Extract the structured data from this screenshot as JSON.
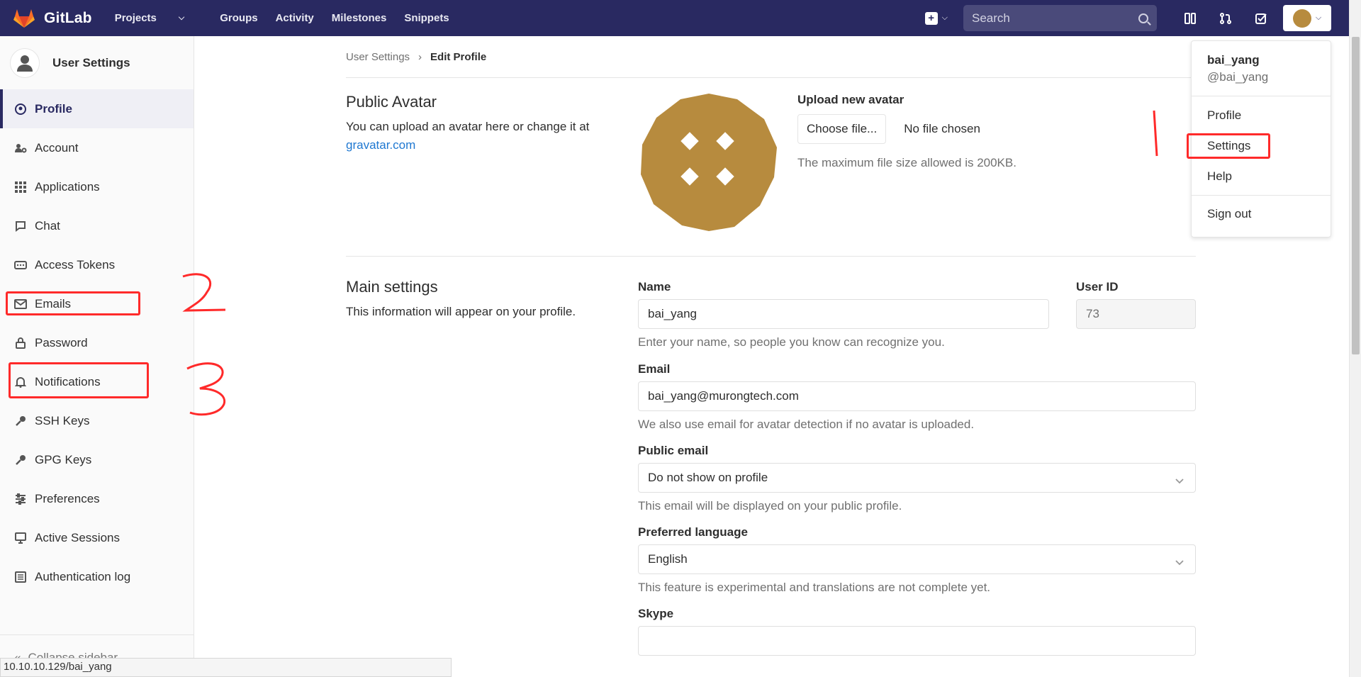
{
  "navbar": {
    "brand": "GitLab",
    "links": [
      {
        "label": "Projects",
        "has_dropdown": true
      },
      {
        "label": "Groups",
        "has_dropdown": false
      },
      {
        "label": "Activity",
        "has_dropdown": false
      },
      {
        "label": "Milestones",
        "has_dropdown": false
      },
      {
        "label": "Snippets",
        "has_dropdown": false
      }
    ],
    "search_placeholder": "Search",
    "colors": {
      "background": "#292961",
      "accent": "#fc6d26"
    }
  },
  "sidebar": {
    "title": "User Settings",
    "items": [
      {
        "label": "Profile",
        "icon": "profile-icon",
        "active": true
      },
      {
        "label": "Account",
        "icon": "account-gears-icon",
        "active": false
      },
      {
        "label": "Applications",
        "icon": "applications-grid-icon",
        "active": false
      },
      {
        "label": "Chat",
        "icon": "chat-bubble-icon",
        "active": false
      },
      {
        "label": "Access Tokens",
        "icon": "access-token-icon",
        "active": false
      },
      {
        "label": "Emails",
        "icon": "envelope-icon",
        "active": false
      },
      {
        "label": "Password",
        "icon": "lock-icon",
        "active": false
      },
      {
        "label": "Notifications",
        "icon": "bell-icon",
        "active": false
      },
      {
        "label": "SSH Keys",
        "icon": "key-icon",
        "active": false
      },
      {
        "label": "GPG Keys",
        "icon": "key-icon",
        "active": false
      },
      {
        "label": "Preferences",
        "icon": "sliders-icon",
        "active": false
      },
      {
        "label": "Active Sessions",
        "icon": "monitor-icon",
        "active": false
      },
      {
        "label": "Authentication log",
        "icon": "log-list-icon",
        "active": false
      }
    ],
    "collapse_label": "Collapse sidebar"
  },
  "breadcrumb": {
    "parent": "User Settings",
    "current": "Edit Profile"
  },
  "avatar_section": {
    "title": "Public Avatar",
    "description": "You can upload an avatar here or change it at",
    "link": "gravatar.com",
    "upload_label": "Upload new avatar",
    "choose_button": "Choose file...",
    "no_file": "No file chosen",
    "max_size": "The maximum file size allowed is 200KB.",
    "avatar_color": "#b78b3e"
  },
  "main_settings": {
    "title": "Main settings",
    "description": "This information will appear on your profile.",
    "name_label": "Name",
    "name_value": "bai_yang",
    "name_help": "Enter your name, so people you know can recognize you.",
    "user_id_label": "User ID",
    "user_id_value": "73",
    "email_label": "Email",
    "email_value": "bai_yang@murongtech.com",
    "email_help": "We also use email for avatar detection if no avatar is uploaded.",
    "public_email_label": "Public email",
    "public_email_value": "Do not show on profile",
    "public_email_help": "This email will be displayed on your public profile.",
    "language_label": "Preferred language",
    "language_value": "English",
    "language_help": "This feature is experimental and translations are not complete yet.",
    "skype_label": "Skype",
    "skype_value": ""
  },
  "user_dropdown": {
    "name": "bai_yang",
    "handle": "@bai_yang",
    "items": [
      "Profile",
      "Settings",
      "Help"
    ],
    "sign_out": "Sign out"
  },
  "status_bar_url": "10.10.10.129/bai_yang",
  "annotations": {
    "color": "#ff2a2a",
    "numbers": [
      "1",
      "2",
      "3"
    ]
  }
}
